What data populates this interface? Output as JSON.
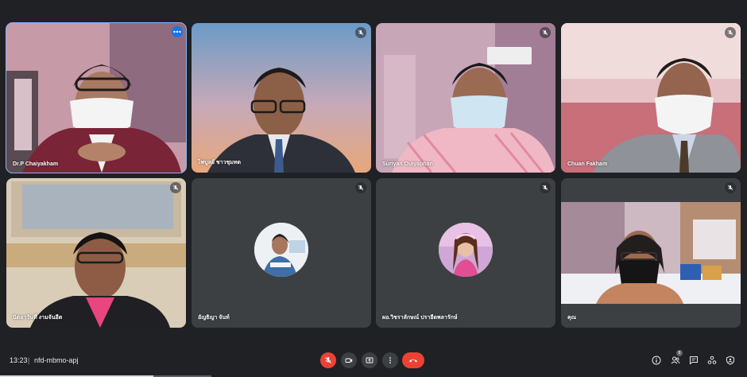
{
  "tiles": [
    {
      "name": "Dr.P Chaiyakham",
      "active": true
    },
    {
      "name": "ไพบูลย์ ชาวชุมทด"
    },
    {
      "name": "Suriyan Ouiyaphan"
    },
    {
      "name": "Chuan Fakham"
    },
    {
      "name": "นิตยาวันที่ งามจันอีต"
    },
    {
      "name": "อัญธิญา จันท์"
    },
    {
      "name": "ผอ.วิชราลักษณ์ ปรายีดพลารักษ์"
    },
    {
      "name": "คุณ"
    }
  ],
  "bottom": {
    "time": "13:23",
    "separator": "|",
    "meeting_code": "nfd-mbmo-apj",
    "participants_count": "8"
  },
  "colors": {
    "background": "#202124",
    "tile": "#3c4043",
    "danger": "#ea4335",
    "accent": "#8ab4f8"
  },
  "icons": [
    "mic-off-icon",
    "more-vert-icon",
    "camera-icon",
    "present-icon",
    "hang-up-icon",
    "info-icon",
    "people-icon",
    "chat-icon",
    "activities-icon",
    "host-controls-icon"
  ]
}
